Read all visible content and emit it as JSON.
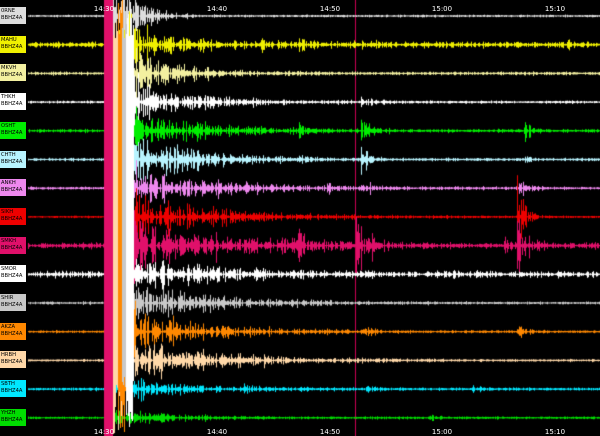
{
  "plot": {
    "background": "#000000",
    "time_ticks_top": [
      "14:30",
      "14:40",
      "14:50",
      "15:00",
      "15:10"
    ],
    "time_ticks_bottom": [
      "14:30",
      "14:40",
      "14:50",
      "15:00",
      "15:10"
    ],
    "event_line_color": "#cc0055"
  },
  "channels": [
    {
      "station": "0RNE",
      "code": "BBHZ4A",
      "color": "#dddddd"
    },
    {
      "station": "MAHU",
      "code": "BBHZ4A",
      "color": "#f0f000"
    },
    {
      "station": "MKVH",
      "code": "BBHZ4A",
      "color": "#f3f0a0"
    },
    {
      "station": "THKH",
      "code": "BBHZ4A",
      "color": "#ffffff"
    },
    {
      "station": "OSHT",
      "code": "BBHZ4A",
      "color": "#00ee00"
    },
    {
      "station": "CHTH",
      "code": "BBHZ4A",
      "color": "#b8f4ff"
    },
    {
      "station": "ANKH",
      "code": "BBHZ4A",
      "color": "#ee88ee"
    },
    {
      "station": "SIKH",
      "code": "BBHZ4A",
      "color": "#ee0000"
    },
    {
      "station": "SMKH",
      "code": "BBHZ4A",
      "color": "#e0106a"
    },
    {
      "station": "SMOR",
      "code": "BBHZ4A",
      "color": "#ffffff"
    },
    {
      "station": "SHIR",
      "code": "BBHZ4A",
      "color": "#c8c8c8"
    },
    {
      "station": "AKZA",
      "code": "BBHZ4A",
      "color": "#ff8800"
    },
    {
      "station": "HRBH",
      "code": "BBHZ4A",
      "color": "#ffd8a8"
    },
    {
      "station": "SBTH",
      "code": "BBHZ4A",
      "color": "#00e8ff"
    },
    {
      "station": "YHZH",
      "code": "BBHZ4A",
      "color": "#00dd00"
    }
  ]
}
